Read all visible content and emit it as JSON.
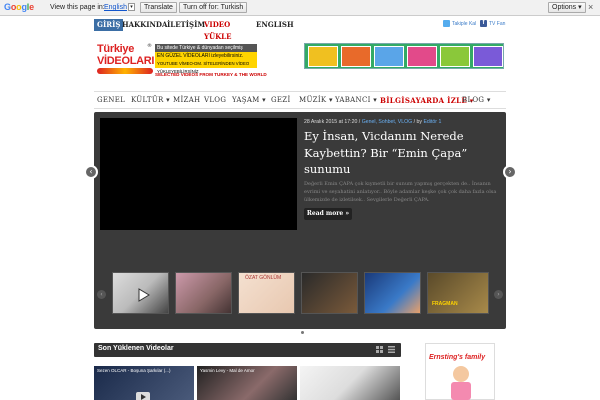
{
  "translate_bar": {
    "logo": "Google",
    "prefix_text": "View this page in:",
    "language": "English",
    "translate_button": "Translate",
    "turn_off_button": "Turn off for: Turkish",
    "options_button": "Options ▾",
    "close": "×"
  },
  "top_nav": {
    "items": [
      {
        "label": "GİRİŞ"
      },
      {
        "label": "HAKKINDA"
      },
      {
        "label": "İLETİŞİM"
      },
      {
        "label": "VIDEO YÜKLE"
      },
      {
        "label": "ENGLISH"
      }
    ],
    "twitter_label": "Takiple Kal",
    "tv_label": "TV Fan"
  },
  "logo": {
    "line1": "Türkiye",
    "line2": "VİDEOLARI",
    "registered": "®",
    "tag1": "Bu sitede Türkiye & dünyadan seçilmiş",
    "tag2": "EN GÜZEL VİDEOLARI izleyebilirsiniz.",
    "tag3": "YOUTUBE VİMEO-DM. SİTELERİNDEN VİDEO YÜKLEYEBİLİRSİNİZ",
    "tag4": "SELECTED VIDEOS FROM TURKEY & THE WORLD"
  },
  "main_nav": {
    "items": [
      {
        "label": "GENEL"
      },
      {
        "label": "KÜLTÜR ▾"
      },
      {
        "label": "MİZAH"
      },
      {
        "label": "VLOG"
      },
      {
        "label": "YAŞAM ▾"
      },
      {
        "label": "GEZİ"
      },
      {
        "label": "MÜZİK ▾"
      },
      {
        "label": "YABANCI ▾"
      },
      {
        "label": "BİLGİSAYARDA İZLE ▾"
      },
      {
        "label": "BLOG ▾"
      }
    ]
  },
  "slider": {
    "date": "28 Aralık 2015 at 17:20 /",
    "categories": "Genel, Sohbet, VLOG",
    "by": "/ by",
    "author": "Editör 1",
    "title": "Ey İnsan, Vicdanını Nerede Kaybettin? Bir “Emin Çapa” sunumu",
    "excerpt": "Değerli Emin ÇAPA çok kıymetli bir sunum yapmış gerçekten de.. İnsanın evrimi ve seyahatini anlatıyor.. Böyle adamlar keşke çok çok daha fazla olsa ülkemizde de izletilsek.. Sevgilerle Değerli ÇAPA.",
    "read_more": "Read more »",
    "prev_arrow": "‹",
    "next_arrow": "›",
    "strip_prev": "‹",
    "strip_next": "›",
    "thumb4_caption": "ÖZAT GÖNLÜM",
    "thumb7_caption": "FRAGMAN"
  },
  "section": {
    "title": "Son Yüklenen Videolar",
    "cards": [
      {
        "caption": "Sezen OLCAR - Boşuna Şarkılar (...)"
      },
      {
        "caption": "Yasmin Levy - Mal de Amor"
      },
      {
        "caption": ""
      }
    ]
  },
  "sidebar_ad": {
    "brand": "Ernsting's family"
  }
}
